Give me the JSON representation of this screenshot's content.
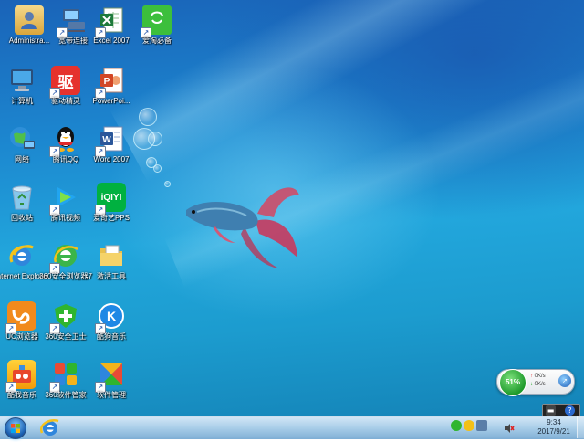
{
  "desktop": {
    "icons": [
      {
        "label": "Administra...",
        "icon": "user-folder-icon",
        "shortcut": false
      },
      {
        "label": "宽带连接",
        "icon": "network-connection-icon",
        "shortcut": true
      },
      {
        "label": "Excel 2007",
        "icon": "excel-icon",
        "shortcut": true
      },
      {
        "label": "爱淘必备",
        "icon": "shopping-bag-icon",
        "shortcut": true
      },
      {
        "label": "计算机",
        "icon": "computer-icon",
        "shortcut": false
      },
      {
        "label": "驱动精灵",
        "icon": "driver-icon",
        "shortcut": true
      },
      {
        "label": "PowerPoi...",
        "icon": "powerpoint-icon",
        "shortcut": true
      },
      {
        "label": "网络",
        "icon": "network-globe-icon",
        "shortcut": false
      },
      {
        "label": "腾讯QQ",
        "icon": "qq-penguin-icon",
        "shortcut": true
      },
      {
        "label": "Word 2007",
        "icon": "word-icon",
        "shortcut": true
      },
      {
        "label": "回收站",
        "icon": "recycle-bin-icon",
        "shortcut": false
      },
      {
        "label": "腾讯视频",
        "icon": "tencent-video-icon",
        "shortcut": true
      },
      {
        "label": "爱奇艺PPS",
        "icon": "iqiyi-icon",
        "shortcut": true
      },
      {
        "label": "Internet Explorer",
        "icon": "internet-explorer-icon",
        "shortcut": false
      },
      {
        "label": "360安全浏览器7",
        "icon": "360-browser-icon",
        "shortcut": true
      },
      {
        "label": "激活工具",
        "icon": "tool-folder-icon",
        "shortcut": false
      },
      {
        "label": "UC浏览器",
        "icon": "uc-browser-icon",
        "shortcut": true
      },
      {
        "label": "360安全卫士",
        "icon": "360-safeguard-icon",
        "shortcut": true
      },
      {
        "label": "酷狗音乐",
        "icon": "kugou-icon",
        "shortcut": true
      },
      {
        "label": "酷我音乐",
        "icon": "kuwo-icon",
        "shortcut": true
      },
      {
        "label": "360软件管家",
        "icon": "360-software-icon",
        "shortcut": true
      },
      {
        "label": "软件管理",
        "icon": "software-manager-icon",
        "shortcut": true
      }
    ],
    "gadget": {
      "percent": "51%",
      "upload": "0K/s",
      "download": "0K/s"
    }
  },
  "taskbar": {
    "time": "9:34",
    "date": "2017/9/21"
  },
  "colors": {
    "excel": "#1e7a3a",
    "powerpoint": "#d24726",
    "word": "#2b579a",
    "qq": "#111111",
    "iqiyi": "#00b140",
    "green360": "#2fb52f"
  }
}
